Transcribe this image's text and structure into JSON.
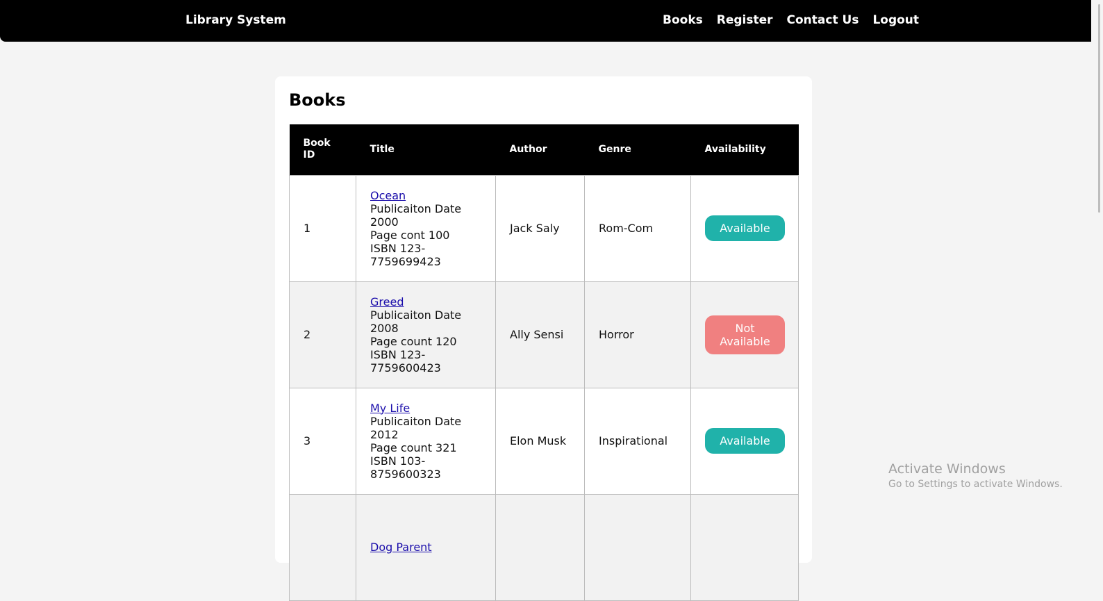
{
  "header": {
    "brand": "Library System",
    "nav": [
      "Books",
      "Register",
      "Contact Us",
      "Logout"
    ]
  },
  "main": {
    "title": "Books",
    "columns": [
      "Book ID",
      "Title",
      "Author",
      "Genre",
      "Availability"
    ],
    "rows": [
      {
        "id": "1",
        "title": "Ocean",
        "details": [
          "Publicaiton Date 2000",
          "Page cont 100",
          "ISBN 123-7759699423"
        ],
        "author": "Jack Saly",
        "genre": "Rom-Com",
        "availability": "Available",
        "status": "available"
      },
      {
        "id": "2",
        "title": "Greed",
        "details": [
          "Publicaiton Date 2008",
          "Page count 120",
          "ISBN 123-7759600423"
        ],
        "author": "Ally Sensi",
        "genre": "Horror",
        "availability": "Not Available",
        "status": "unavailable"
      },
      {
        "id": "3",
        "title": "My Life",
        "details": [
          "Publicaiton Date 2012",
          "Page count 321",
          "ISBN 103-8759600323"
        ],
        "author": "Elon Musk",
        "genre": "Inspirational",
        "availability": "Available",
        "status": "available"
      },
      {
        "id": "",
        "title": "Dog Parent",
        "details": [],
        "author": "",
        "genre": "",
        "availability": "",
        "status": ""
      }
    ]
  },
  "colors": {
    "available": "#20b2aa",
    "unavailable": "#f08080",
    "header_bg": "#000000",
    "alt_row_bg": "#f2f2f2",
    "link": "#1a0dab"
  },
  "watermark": {
    "title": "Activate Windows",
    "subtitle": "Go to Settings to activate Windows."
  }
}
